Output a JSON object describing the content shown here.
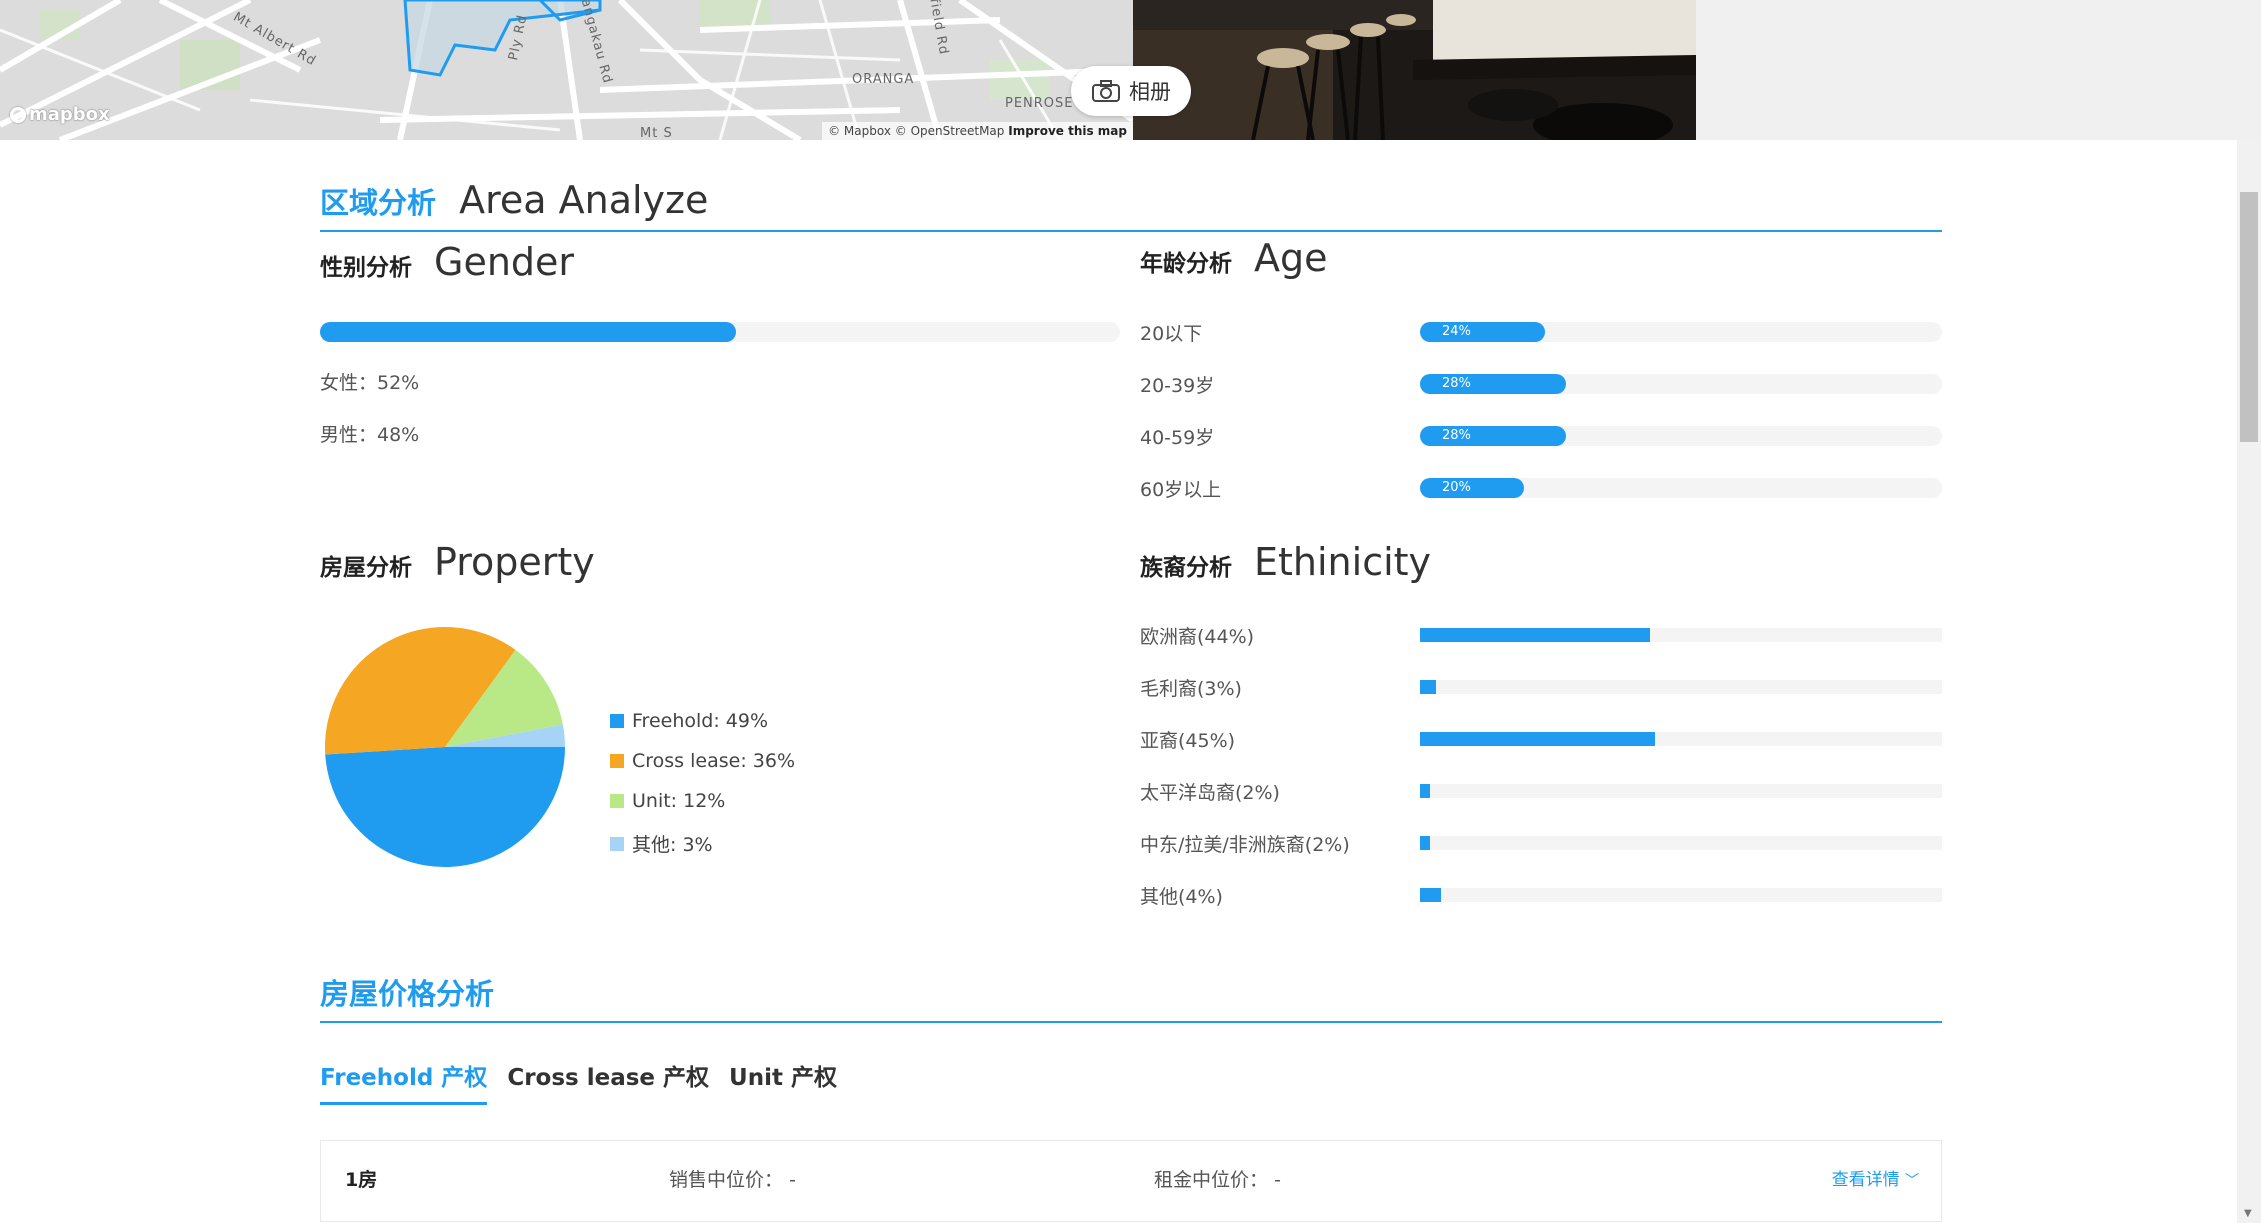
{
  "map": {
    "labels": [
      "Mt Albert Rd",
      "Ply Rd",
      "Mangakau Rd",
      "kfield Rd",
      "ORANGA",
      "PENROSE",
      "Mt S"
    ],
    "logo": "mapbox",
    "attribution_prefix": "© Mapbox © OpenStreetMap",
    "attribution_link": "Improve this map"
  },
  "album": {
    "icon": "camera-icon",
    "label": "相册"
  },
  "area": {
    "title_cn": "区域分析",
    "title_en": "Area Analyze"
  },
  "gender": {
    "title_cn": "性别分析",
    "title_en": "Gender",
    "female_share": 0.52,
    "female_label": "女性：52%",
    "male_label": "男性：48%"
  },
  "age": {
    "title_cn": "年龄分析",
    "title_en": "Age",
    "rows": [
      {
        "label": "20以下",
        "value": 24,
        "pct": "24%"
      },
      {
        "label": "20-39岁",
        "value": 28,
        "pct": "28%"
      },
      {
        "label": "40-59岁",
        "value": 28,
        "pct": "28%"
      },
      {
        "label": "60岁以上",
        "value": 20,
        "pct": "20%"
      }
    ]
  },
  "property": {
    "title_cn": "房屋分析",
    "title_en": "Property",
    "legend": [
      {
        "label": "Freehold: 49%",
        "color": "#1f9cf0"
      },
      {
        "label": "Cross lease: 36%",
        "color": "#f5a623"
      },
      {
        "label": "Unit: 12%",
        "color": "#b8e986"
      },
      {
        "label": "其他: 3%",
        "color": "#a5d4f7"
      }
    ]
  },
  "chart_data": {
    "type": "pie",
    "categories": [
      "Freehold",
      "Cross lease",
      "Unit",
      "其他"
    ],
    "values": [
      49,
      36,
      12,
      3
    ],
    "colors": [
      "#1f9cf0",
      "#f5a623",
      "#b8e986",
      "#a5d4f7"
    ]
  },
  "ethnicity": {
    "title_cn": "族裔分析",
    "title_en": "Ethinicity",
    "rows": [
      {
        "label": "欧洲裔(44%)",
        "value": 44
      },
      {
        "label": "毛利裔(3%)",
        "value": 3
      },
      {
        "label": "亚裔(45%)",
        "value": 45
      },
      {
        "label": "太平洋岛裔(2%)",
        "value": 2
      },
      {
        "label": "中东/拉美/非洲族裔(2%)",
        "value": 2
      },
      {
        "label": "其他(4%)",
        "value": 4
      }
    ]
  },
  "price": {
    "title_cn": "房屋价格分析",
    "tabs": [
      "Freehold 产权",
      "Cross lease 产权",
      "Unit 产权"
    ],
    "row": {
      "room": "1房",
      "sale_label": "销售中位价：",
      "sale_value": "-",
      "rent_label": "租金中位价：",
      "rent_value": "-",
      "more": "查看详情"
    }
  }
}
